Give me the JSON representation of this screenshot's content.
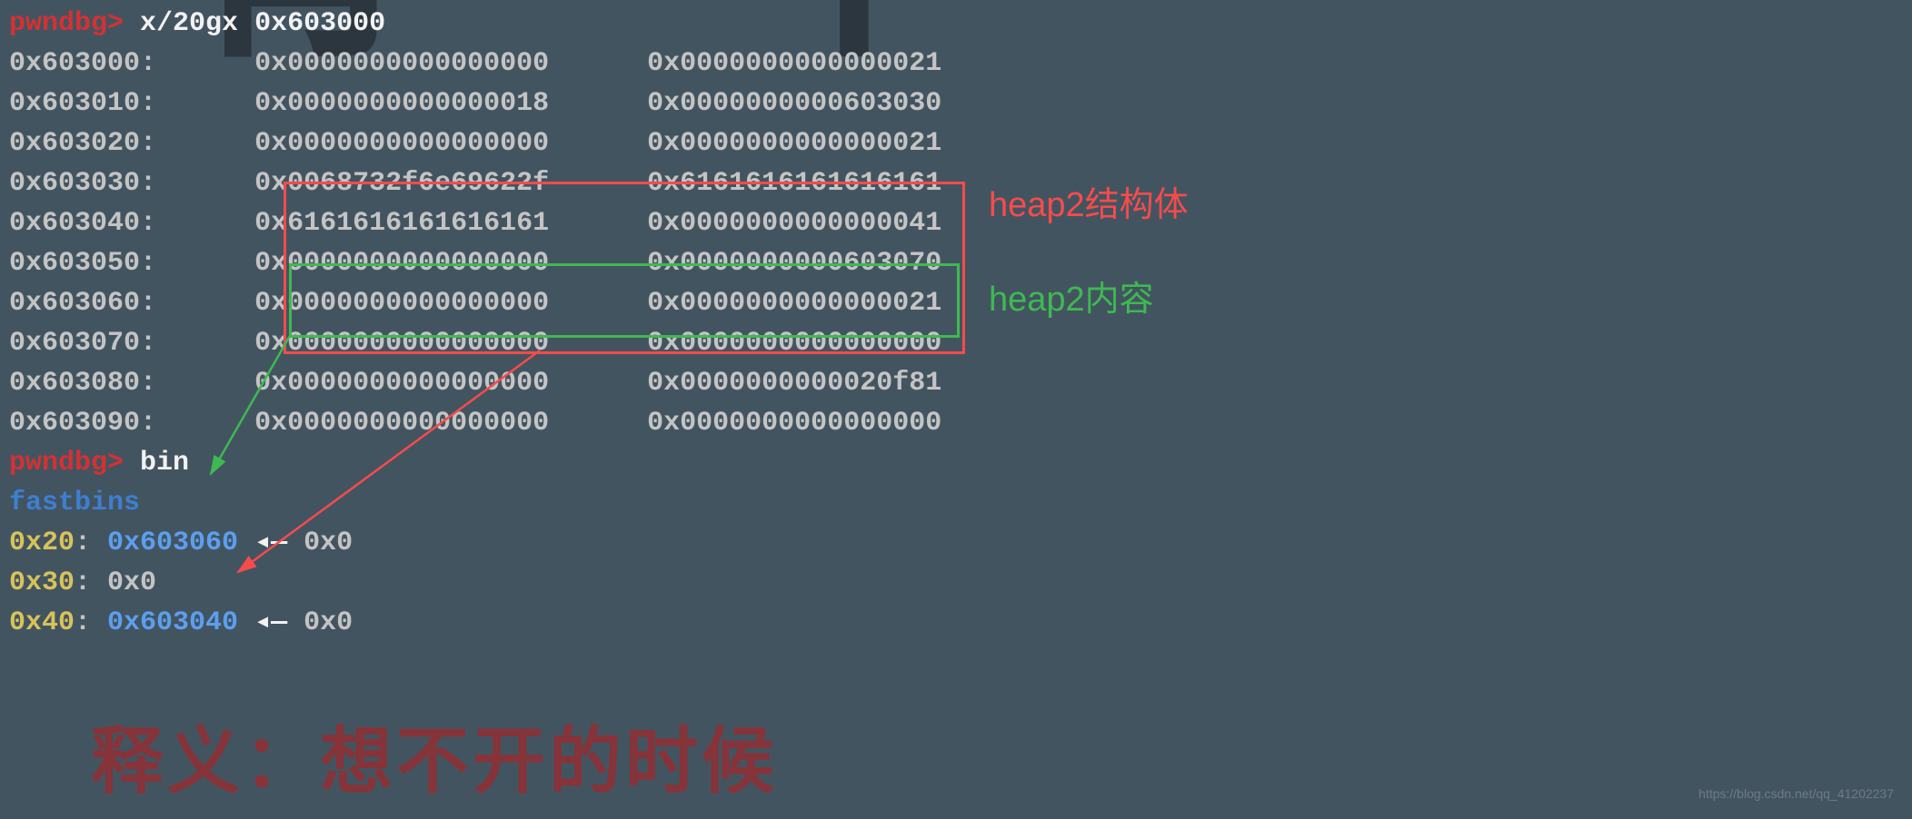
{
  "prompt": "pwndbg>",
  "cmd1": "x/20gx 0x603000",
  "memory": [
    {
      "addr": "0x603000:",
      "v1": "0x0000000000000000",
      "v2": "0x0000000000000021"
    },
    {
      "addr": "0x603010:",
      "v1": "0x0000000000000018",
      "v2": "0x0000000000603030"
    },
    {
      "addr": "0x603020:",
      "v1": "0x0000000000000000",
      "v2": "0x0000000000000021"
    },
    {
      "addr": "0x603030:",
      "v1": "0x0068732f6e69622f",
      "v2": "0x6161616161616161"
    },
    {
      "addr": "0x603040:",
      "v1": "0x6161616161616161",
      "v2": "0x0000000000000041"
    },
    {
      "addr": "0x603050:",
      "v1": "0x0000000000000000",
      "v2": "0x0000000000603070"
    },
    {
      "addr": "0x603060:",
      "v1": "0x0000000000000000",
      "v2": "0x0000000000000021"
    },
    {
      "addr": "0x603070:",
      "v1": "0x0000000000000000",
      "v2": "0x0000000000000000"
    },
    {
      "addr": "0x603080:",
      "v1": "0x0000000000000000",
      "v2": "0x0000000000020f81"
    },
    {
      "addr": "0x603090:",
      "v1": "0x0000000000000000",
      "v2": "0x0000000000000000"
    }
  ],
  "cmd2": "bin",
  "fastbins_label": "fastbins",
  "bins": [
    {
      "size": "0x20",
      "ptr": "0x603060",
      "arrow": "◂—",
      "next": "0x0"
    },
    {
      "size": "0x30",
      "ptr": "0x0",
      "arrow": "",
      "next": ""
    },
    {
      "size": "0x40",
      "ptr": "0x603040",
      "arrow": "◂—",
      "next": "0x0"
    }
  ],
  "labels": {
    "struct": "heap2结构体",
    "content": "heap2内容"
  },
  "bg_chars": {
    "c1": "有",
    "c2": "不"
  },
  "bg_bottom": "释义：想不开的时候",
  "watermark": "https://blog.csdn.net/qq_41202237"
}
